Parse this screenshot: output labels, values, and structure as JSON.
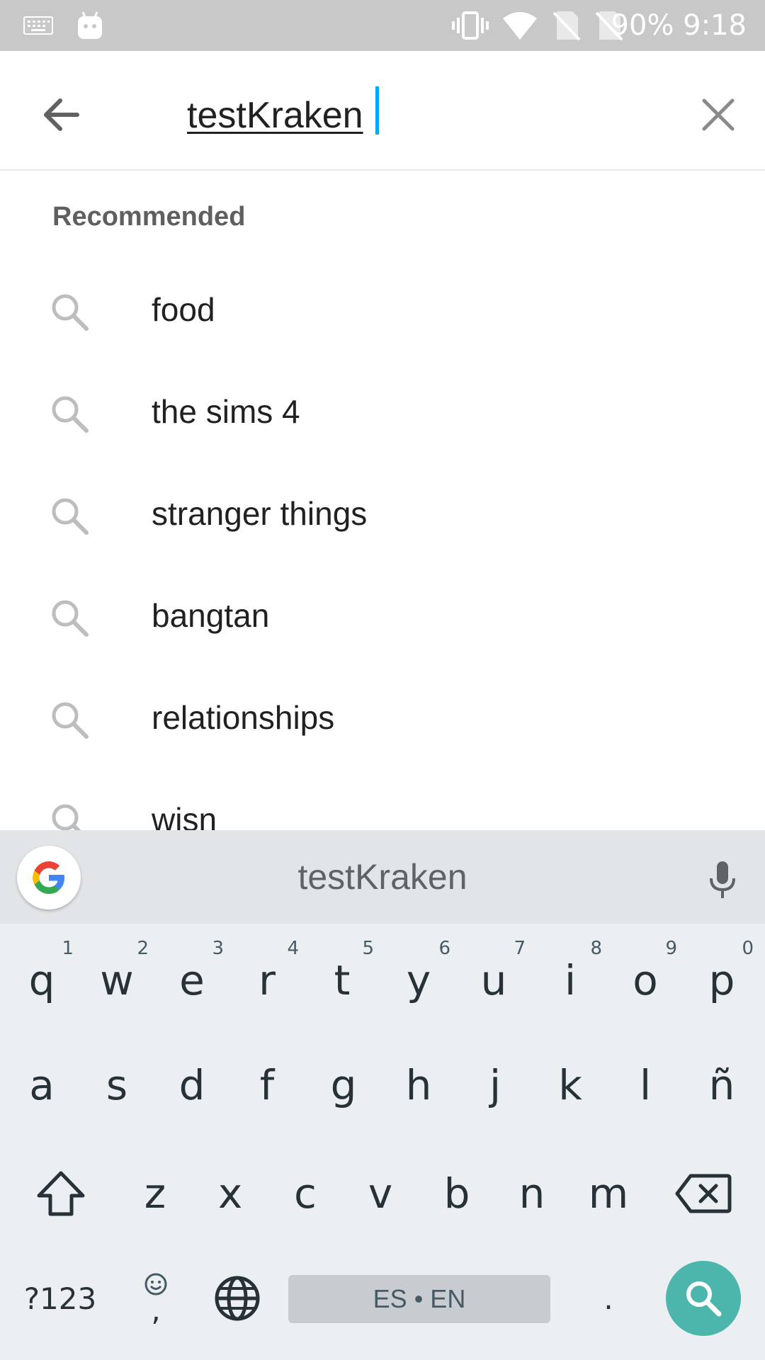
{
  "status_bar": {
    "icons": [
      "keyboard-icon",
      "android-icon",
      "vibrate-icon",
      "wifi-icon",
      "no-sim-icon",
      "no-sim-icon"
    ],
    "battery": "90%",
    "time": "9:18"
  },
  "search": {
    "query": "testKraken",
    "back_icon": "arrow-back-icon",
    "clear_icon": "close-icon"
  },
  "suggestions": {
    "header": "Recommended",
    "items": [
      {
        "label": "food"
      },
      {
        "label": "the sims 4"
      },
      {
        "label": "stranger things"
      },
      {
        "label": "bangtan"
      },
      {
        "label": "relationships"
      },
      {
        "label": "wisn"
      }
    ]
  },
  "keyboard": {
    "suggestion": "testKraken",
    "row1": [
      {
        "key": "q",
        "num": "1"
      },
      {
        "key": "w",
        "num": "2"
      },
      {
        "key": "e",
        "num": "3"
      },
      {
        "key": "r",
        "num": "4"
      },
      {
        "key": "t",
        "num": "5"
      },
      {
        "key": "y",
        "num": "6"
      },
      {
        "key": "u",
        "num": "7"
      },
      {
        "key": "i",
        "num": "8"
      },
      {
        "key": "o",
        "num": "9"
      },
      {
        "key": "p",
        "num": "0"
      }
    ],
    "row2": [
      "a",
      "s",
      "d",
      "f",
      "g",
      "h",
      "j",
      "k",
      "l",
      "ñ"
    ],
    "row3": [
      "z",
      "x",
      "c",
      "v",
      "b",
      "n",
      "m"
    ],
    "symbols_label": "?123",
    "comma_label": ",",
    "space_label": "ES • EN",
    "period_label": ".",
    "accent_color": "#4db6ac"
  }
}
